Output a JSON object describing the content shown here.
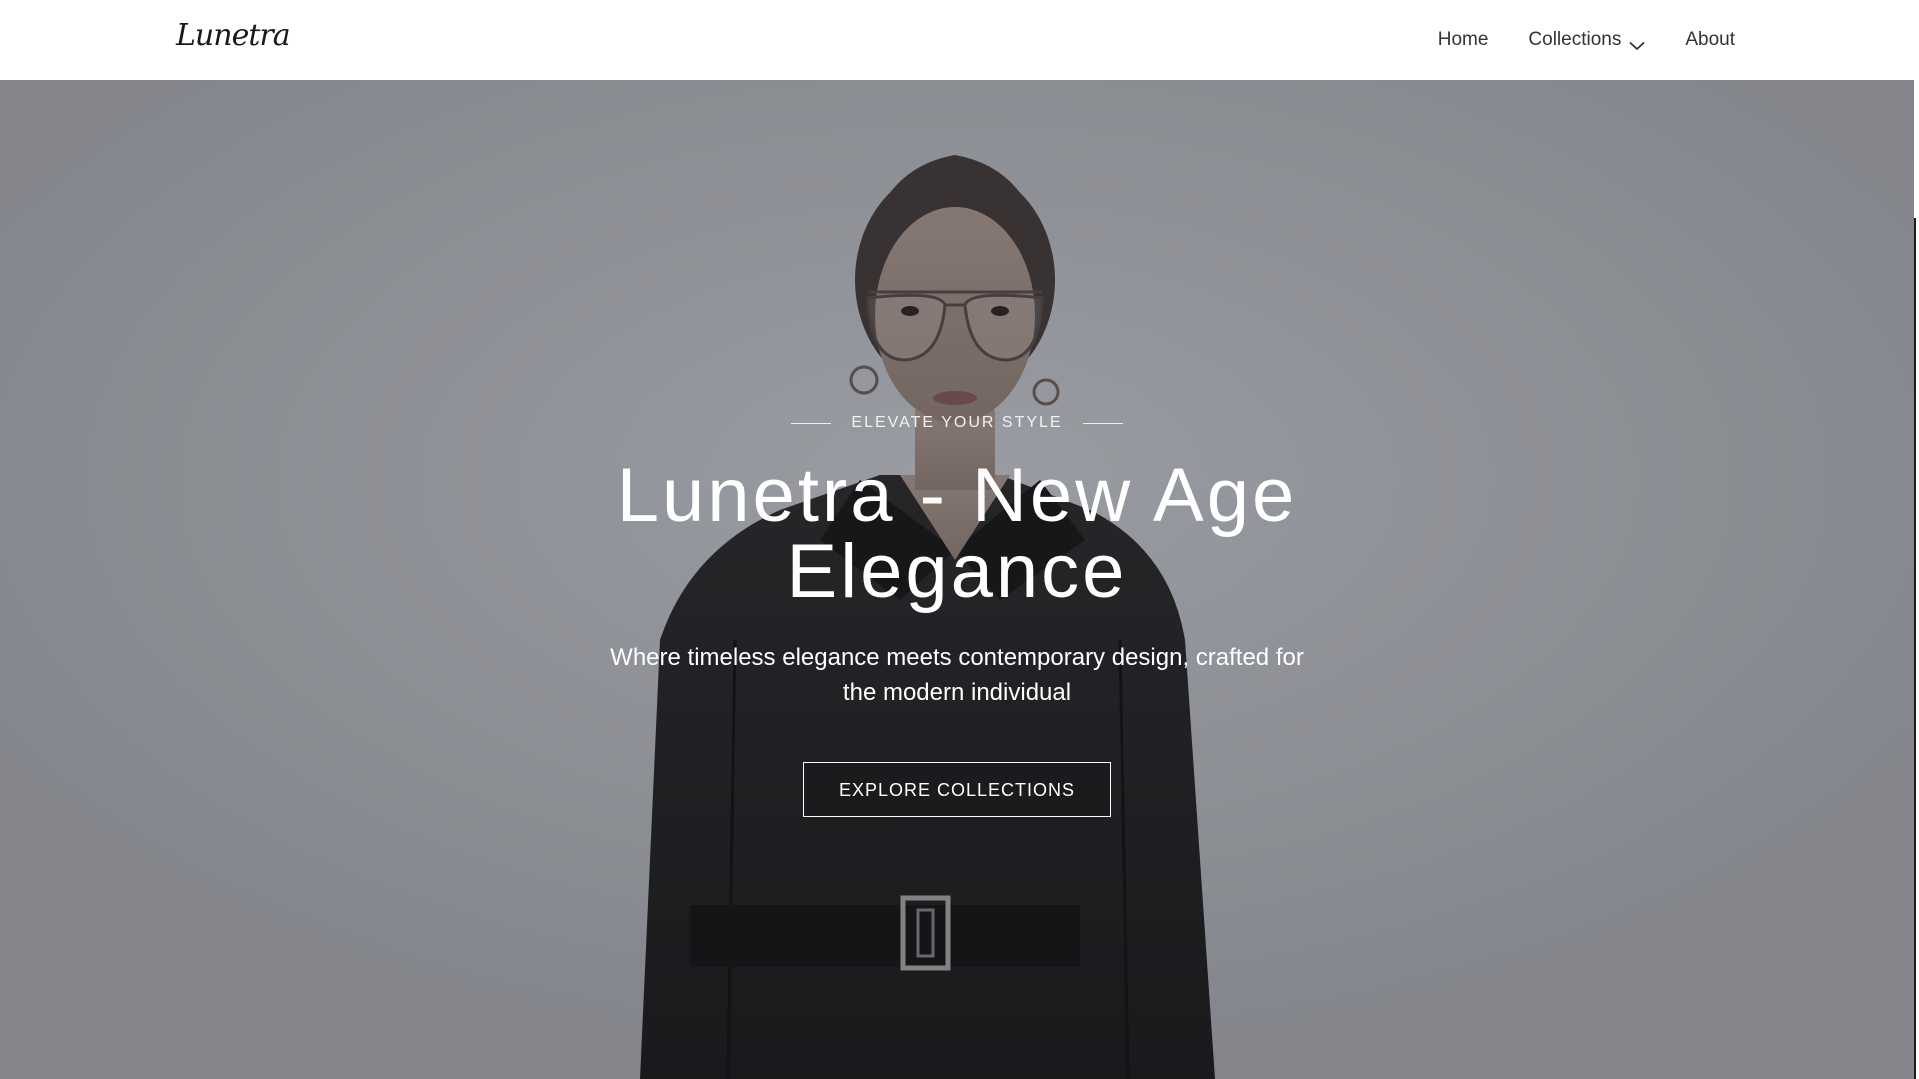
{
  "header": {
    "logo_text": "Lunetra",
    "nav": {
      "home": "Home",
      "collections": "Collections",
      "about": "About"
    }
  },
  "hero": {
    "eyebrow": "ELEVATE YOUR STYLE",
    "title_line1": "Lunetra - New Age",
    "title_line2": "Elegance",
    "subtitle": "Where timeless elegance meets contemporary design, crafted for the modern individual",
    "cta_label": "EXPLORE COLLECTIONS"
  },
  "colors": {
    "header_bg": "#ffffff",
    "nav_text": "#333333",
    "hero_bg": "#9a9da3",
    "hero_text": "#ffffff",
    "garment": "#1e1e21"
  },
  "icons": {
    "dropdown": "chevron-down-icon"
  }
}
